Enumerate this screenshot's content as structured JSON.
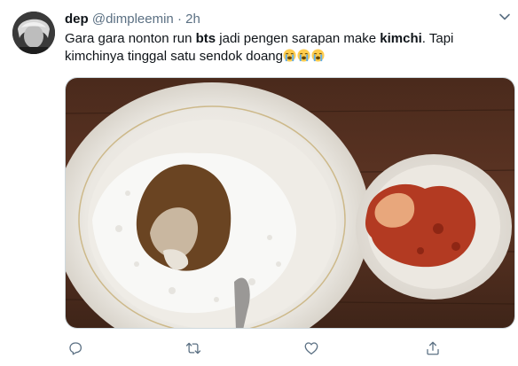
{
  "tweet": {
    "display_name": "dep",
    "handle": "@dimpleemin",
    "separator": "·",
    "time": "2h",
    "text_parts": [
      "Gara gara nonton run ",
      "bts",
      " jadi pengen sarapan make ",
      "kimchi",
      ". Tapi kimchinya tinggal satu sendok doang"
    ],
    "emojis": [
      "loudly-crying-face",
      "loudly-crying-face",
      "loudly-crying-face"
    ]
  },
  "media": {
    "subject": "rice with kimchi on a white plate and a small bowl of kimchi on a wooden table"
  },
  "actions": [
    "reply-icon",
    "retweet-icon",
    "like-icon",
    "share-icon"
  ],
  "colors": {
    "text": "#0f1419",
    "secondary": "#5b7083",
    "icon": "#5b7083",
    "border": "#cfd9de"
  }
}
